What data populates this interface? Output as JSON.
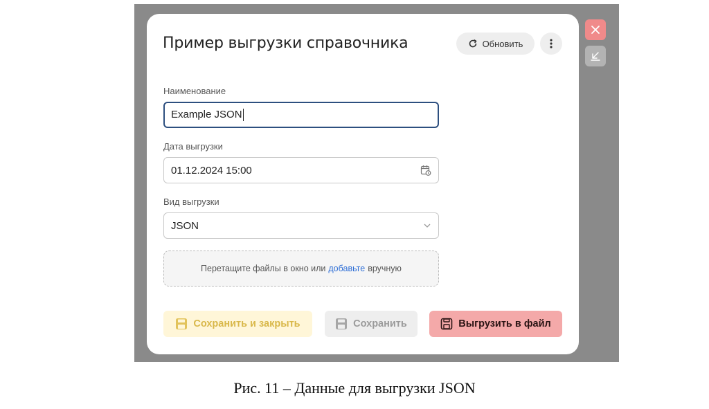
{
  "dialog": {
    "title": "Пример выгрузки справочника",
    "refresh_label": "Обновить"
  },
  "form": {
    "name_label": "Наименование",
    "name_value": "Example JSON",
    "date_label": "Дата выгрузки",
    "date_value": "01.12.2024 15:00",
    "type_label": "Вид выгрузки",
    "type_value": "JSON"
  },
  "dropzone": {
    "text_before": "Перетащите файлы в окно или",
    "link": "добавьте",
    "text_after": "вручную"
  },
  "actions": {
    "save_close": "Сохранить и закрыть",
    "save": "Сохранить",
    "export": "Выгрузить в файл"
  },
  "caption": "Рис. 11 – Данные для выгрузки JSON",
  "colors": {
    "overlay": "#8a8a8a",
    "focus_border": "#2d4f7f",
    "link": "#2f6fd6",
    "save_close_bg": "#fff6d8",
    "save_close_fg": "#d9b84a",
    "export_bg": "#f4a9a9",
    "close_bg": "#f08a8a"
  },
  "icons": [
    "refresh-icon",
    "more-vertical-icon",
    "close-icon",
    "minimize-icon",
    "calendar-icon",
    "chevron-down-icon",
    "floppy-disk-icon"
  ]
}
